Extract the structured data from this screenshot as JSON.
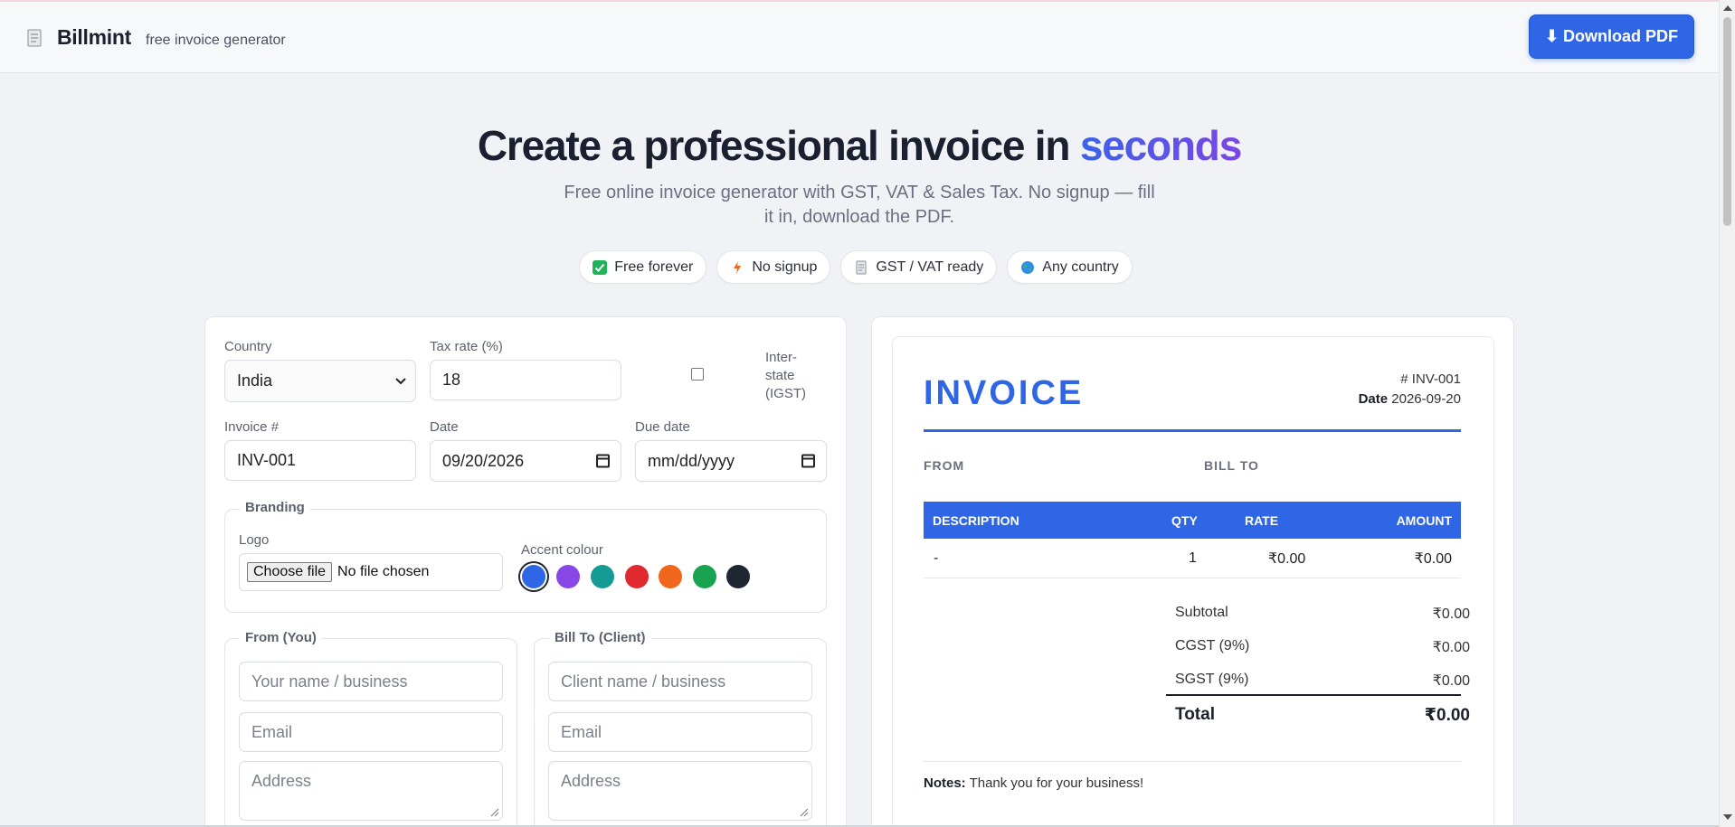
{
  "header": {
    "brand_name": "Billmint",
    "brand_tagline": "free invoice generator",
    "download_label": "⬇ Download PDF"
  },
  "hero": {
    "title_main": "Create a professional invoice in ",
    "title_accent": "seconds",
    "subtitle": "Free online invoice generator with GST, VAT & Sales Tax. No signup — fill it in, download the PDF.",
    "chips": [
      {
        "icon": "check-box-icon",
        "label": "Free forever"
      },
      {
        "icon": "lightning-icon",
        "label": "No signup"
      },
      {
        "icon": "receipt-icon",
        "label": "GST / VAT ready"
      },
      {
        "icon": "globe-icon",
        "label": "Any country"
      }
    ]
  },
  "form": {
    "country_label": "Country",
    "country_value": "India",
    "tax_rate_label": "Tax rate (%)",
    "tax_rate_value": "18",
    "interstate_label": "Inter-state (IGST)",
    "interstate_checked": false,
    "invoice_no_label": "Invoice #",
    "invoice_no_value": "INV-001",
    "date_label": "Date",
    "date_value": "09/20/2026",
    "due_date_label": "Due date",
    "due_date_placeholder": "mm/dd/yyyy",
    "branding": {
      "legend": "Branding",
      "logo_label": "Logo",
      "file_button": "Choose file",
      "file_status": "No file chosen",
      "accent_label": "Accent colour",
      "accent_colors": [
        "#2f66e6",
        "#8a47e8",
        "#159a94",
        "#e0292f",
        "#f0661c",
        "#19a24f",
        "#1f2733"
      ],
      "selected_color": "#2f66e6"
    },
    "from": {
      "legend": "From (You)",
      "name_placeholder": "Your name / business",
      "email_placeholder": "Email",
      "address_placeholder": "Address"
    },
    "bill_to": {
      "legend": "Bill To (Client)",
      "name_placeholder": "Client name / business",
      "email_placeholder": "Email",
      "address_placeholder": "Address"
    }
  },
  "preview": {
    "title": "INVOICE",
    "number": "# INV-001",
    "date_label": "Date",
    "date_value": "2026-09-20",
    "from_label": "FROM",
    "bill_to_label": "BILL TO",
    "columns": [
      "DESCRIPTION",
      "QTY",
      "RATE",
      "AMOUNT"
    ],
    "row": {
      "description": "-",
      "qty": "1",
      "rate": "₹0.00",
      "amount": "₹0.00"
    },
    "subtotal_label": "Subtotal",
    "subtotal_value": "₹0.00",
    "cgst_label": "CGST (9%)",
    "cgst_value": "₹0.00",
    "sgst_label": "SGST (9%)",
    "sgst_value": "₹0.00",
    "total_label": "Total",
    "total_value": "₹0.00",
    "notes_label": "Notes:",
    "notes_text": "Thank you for your business!"
  }
}
